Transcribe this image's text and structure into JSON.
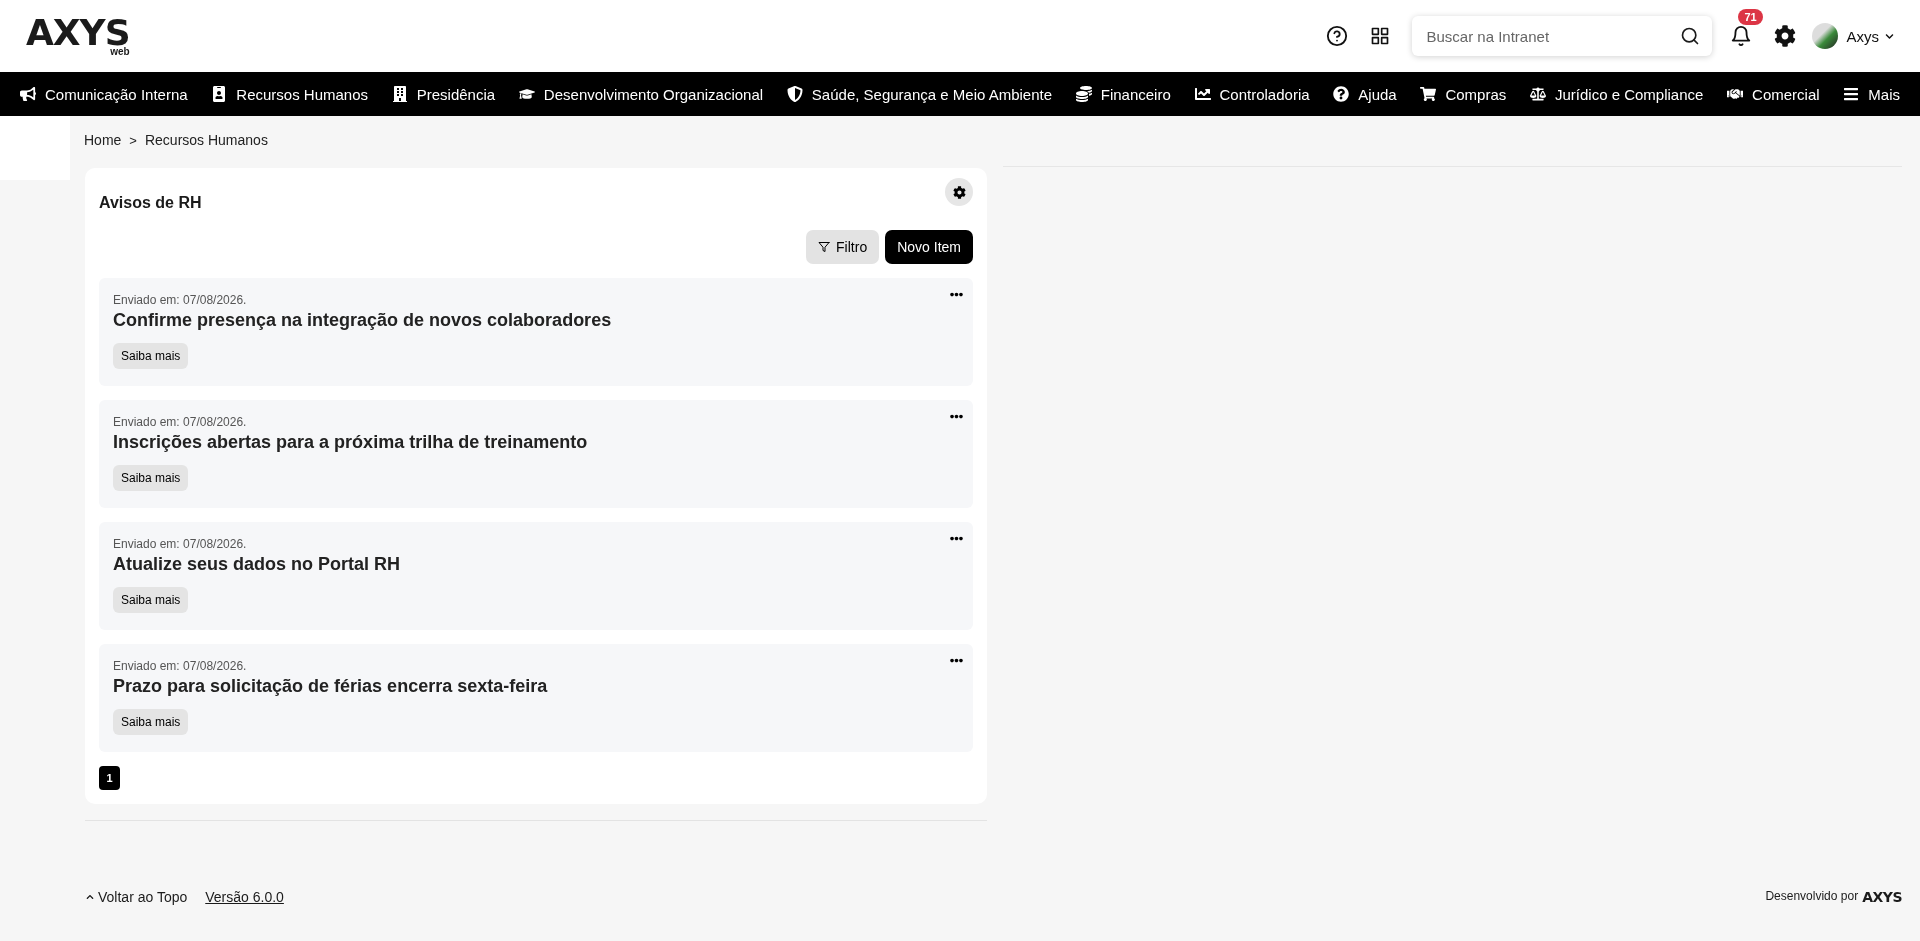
{
  "header": {
    "logo": {
      "brand": "AXYS",
      "sub": "web"
    },
    "search": {
      "placeholder": "Buscar na Intranet"
    },
    "notifications": {
      "count": "71"
    },
    "user": {
      "name": "Axys"
    }
  },
  "nav": [
    "Comunicação Interna",
    "Recursos Humanos",
    "Presidência",
    "Desenvolvimento Organizacional",
    "Saúde, Segurança e Meio Ambiente",
    "Financeiro",
    "Controladoria",
    "Ajuda",
    "Compras",
    "Jurídico e Compliance",
    "Comercial",
    "Mais"
  ],
  "breadcrumb": {
    "separator": ">",
    "items": [
      "Home",
      "Recursos Humanos"
    ]
  },
  "card": {
    "title": "Avisos de RH",
    "buttons": {
      "filter": "Filtro",
      "new": "Novo Item"
    },
    "items": [
      {
        "sent": "Enviado em: 07/08/2026.",
        "title": "Confirme presença na integração de novos colaboradores",
        "action": "Saiba mais"
      },
      {
        "sent": "Enviado em: 07/08/2026.",
        "title": "Inscrições abertas para a próxima trilha de treinamento",
        "action": "Saiba mais"
      },
      {
        "sent": "Enviado em: 07/08/2026.",
        "title": "Atualize seus dados no Portal RH",
        "action": "Saiba mais"
      },
      {
        "sent": "Enviado em: 07/08/2026.",
        "title": "Prazo para solicitação de férias encerra sexta-feira",
        "action": "Saiba mais"
      }
    ],
    "pages": [
      {
        "label": "1",
        "selected": true
      }
    ]
  },
  "footer": {
    "back_to_top": "Voltar ao Topo",
    "version": "Versão 6.0.0",
    "credit": "Desenvolvido por",
    "credit_logo": "AXYS"
  }
}
